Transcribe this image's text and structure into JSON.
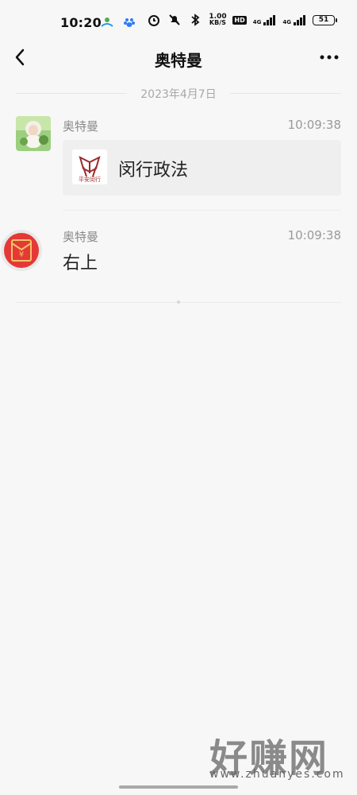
{
  "status_bar": {
    "time": "10:20",
    "network_speed_value": "1.00",
    "network_speed_unit": "KB/S",
    "hd_label": "HD",
    "sim1_label": "4G",
    "sim2_label": "4G",
    "battery": "51"
  },
  "nav": {
    "title": "奥特曼"
  },
  "chat": {
    "date_divider": "2023年4月7日",
    "messages": [
      {
        "sender": "奥特曼",
        "time": "10:09:38",
        "card_title": "闵行政法",
        "card_logo_caption": "平安闵行"
      },
      {
        "sender": "奥特曼",
        "time": "10:09:38",
        "text": "右上"
      }
    ]
  },
  "watermark": {
    "title": "好赚网",
    "url": "www.zhuanyes.com"
  },
  "colors": {
    "red_packet": "#e53935",
    "gold": "#f3c36a"
  }
}
